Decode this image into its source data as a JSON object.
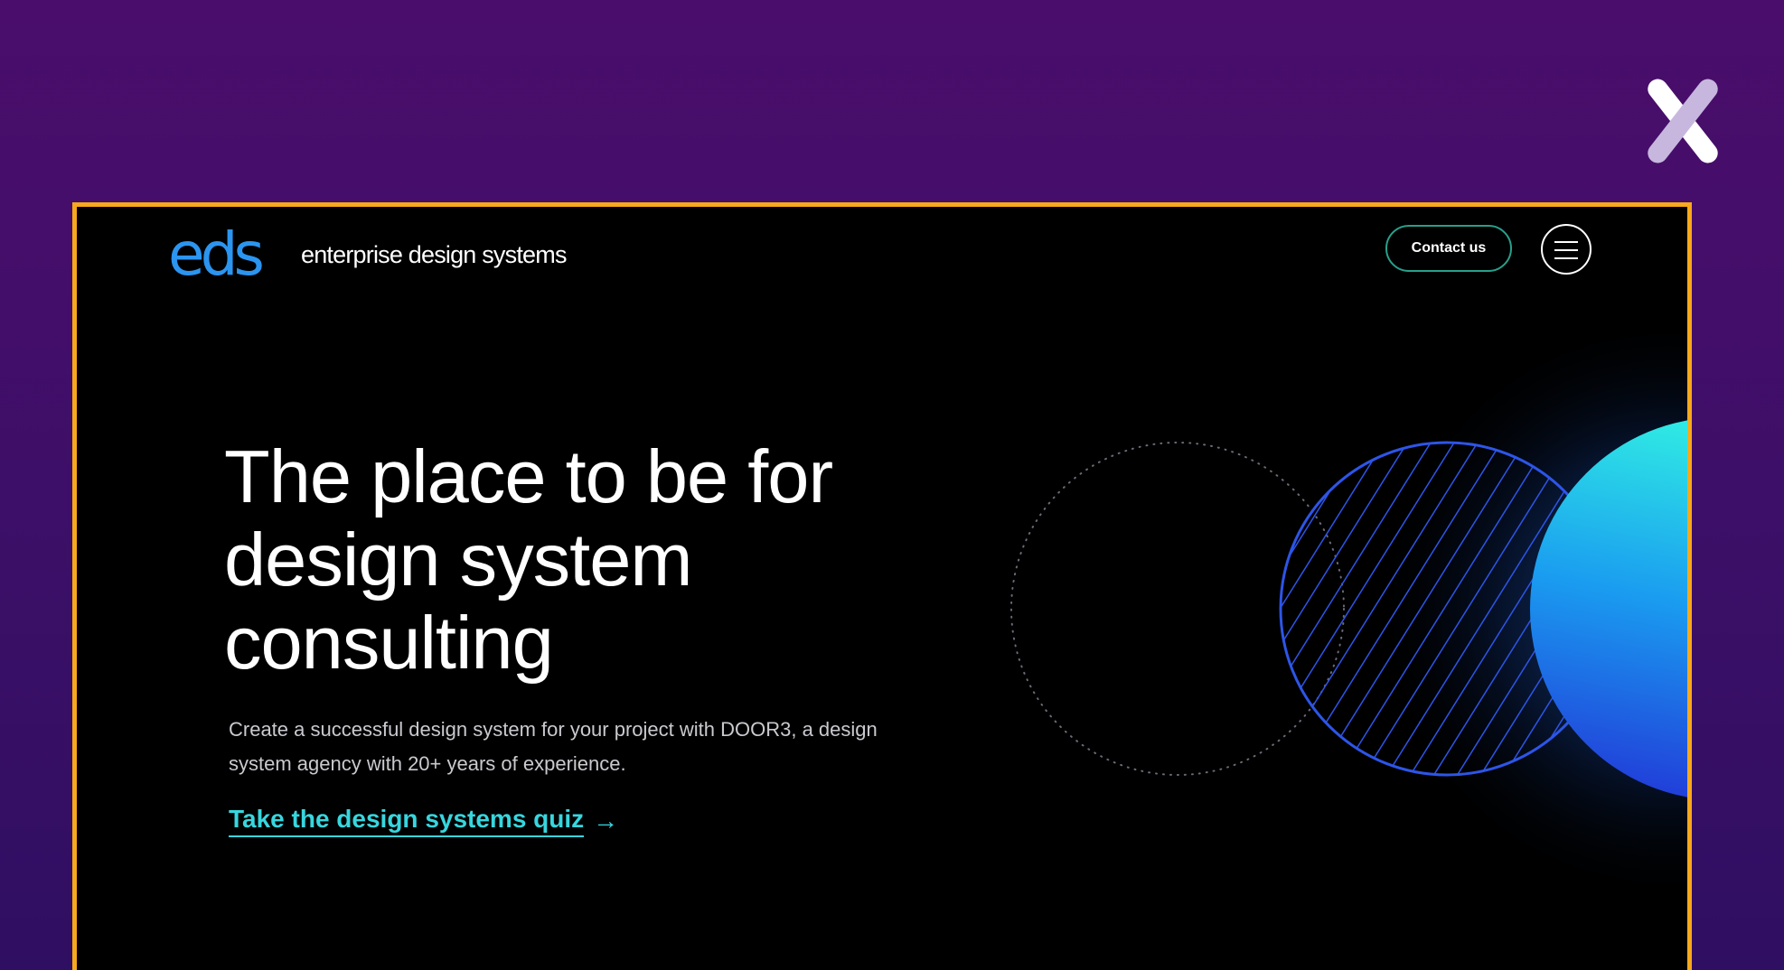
{
  "overlay": {
    "logo_icon": "x-logo-icon"
  },
  "header": {
    "brand_mark_e": "e",
    "brand_mark_ds": "ds",
    "brand_name": "enterprise design systems",
    "contact_label": "Contact us",
    "menu_icon": "hamburger-menu-icon"
  },
  "hero": {
    "title": "The place to be for design system consulting",
    "subtitle": "Create a successful design system for your project with DOOR3, a design system agency with 20+ years of experience.",
    "quiz_link": "Take the design systems quiz",
    "quiz_arrow": "→"
  },
  "colors": {
    "background_purple": "#4a0d6b",
    "frame_border": "#f7a81b",
    "brand_blue": "#1f6fe0",
    "link_cyan": "#37d6de",
    "button_border": "#28a08c"
  }
}
